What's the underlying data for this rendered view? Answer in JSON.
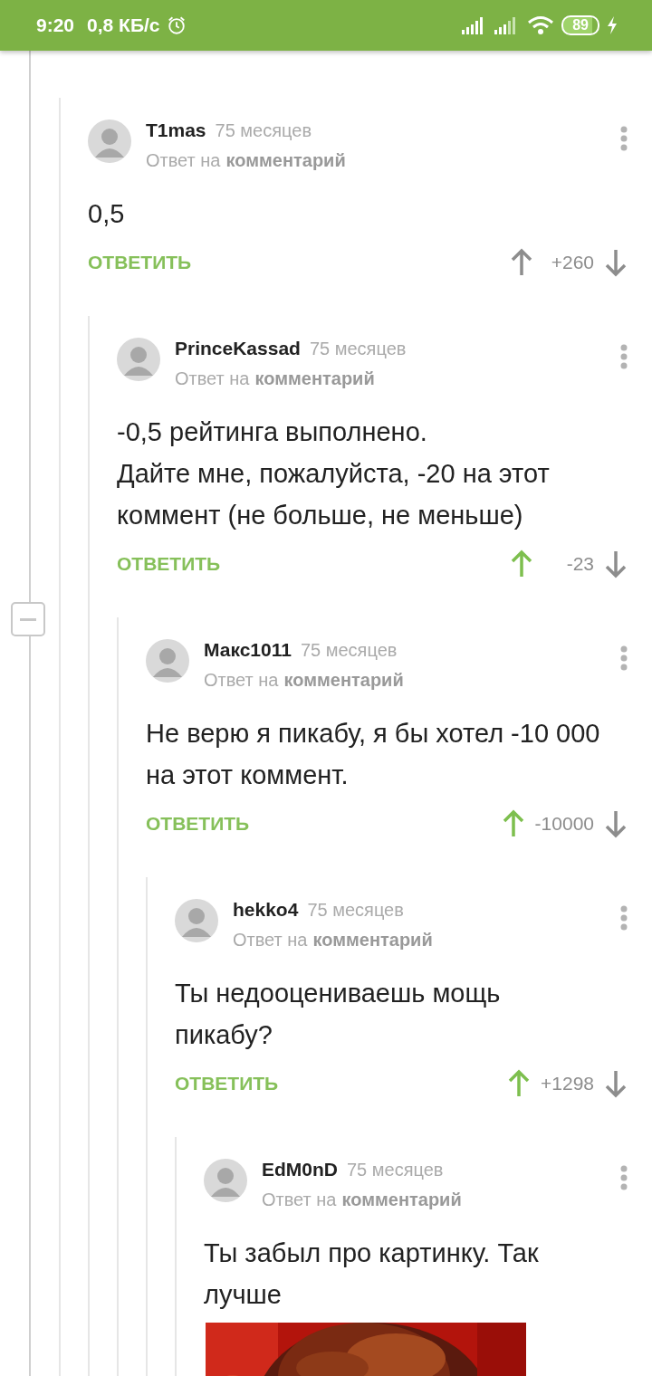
{
  "status_bar": {
    "time": "9:20",
    "speed": "0,8 КБ/с",
    "battery": "89",
    "charging": true
  },
  "comments": [
    {
      "author": "T1mas",
      "age": "75 месяцев",
      "reply_prefix": "Ответ на",
      "reply_link": "комментарий",
      "body": [
        "0,5"
      ],
      "reply_label": "ОТВЕТИТЬ",
      "rating": "+260",
      "upvoted": false,
      "children": [
        {
          "author": "PrinceKassad",
          "age": "75 месяцев",
          "reply_prefix": "Ответ на",
          "reply_link": "комментарий",
          "body": [
            "-0,5 рейтинга выполнено.",
            "Дайте мне, пожалуйста, -20 на этот коммент (не больше, не меньше)"
          ],
          "reply_label": "ОТВЕТИТЬ",
          "rating": "-23",
          "upvoted": true,
          "children": [
            {
              "author": "Макс1011",
              "age": "75 месяцев",
              "reply_prefix": "Ответ на",
              "reply_link": "комментарий",
              "body": [
                "Не верю я пикабу, я бы хотел -10 000 на этот коммент."
              ],
              "reply_label": "ОТВЕТИТЬ",
              "rating": "-10000",
              "upvoted": true,
              "children": [
                {
                  "author": "hekko4",
                  "age": "75 месяцев",
                  "reply_prefix": "Ответ на",
                  "reply_link": "комментарий",
                  "body": [
                    "Ты недооцениваешь мощь пикабу?"
                  ],
                  "reply_label": "ОТВЕТИТЬ",
                  "rating": "+1298",
                  "upvoted": true,
                  "children": [
                    {
                      "author": "EdM0nD",
                      "age": "75 месяцев",
                      "reply_prefix": "Ответ на",
                      "reply_link": "комментарий",
                      "body": [
                        "Ты забыл про картинку. Так лучше"
                      ],
                      "attachment": {
                        "kind": "picture"
                      }
                    }
                  ]
                }
              ]
            }
          ]
        }
      ]
    }
  ]
}
